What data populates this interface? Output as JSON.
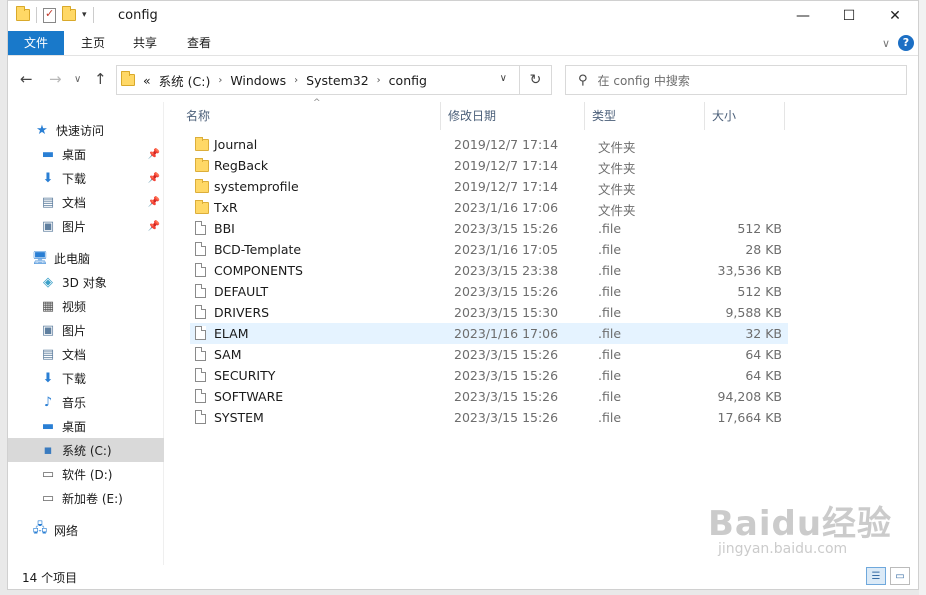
{
  "window": {
    "title": "config",
    "minimize": "—",
    "maximize": "☐",
    "close": "✕"
  },
  "ribbon": {
    "tabs": [
      "文件",
      "主页",
      "共享",
      "查看"
    ],
    "help": "?"
  },
  "address": {
    "overflow": "«",
    "crumbs": [
      "系统 (C:)",
      "Windows",
      "System32",
      "config"
    ]
  },
  "search": {
    "placeholder": "在 config 中搜索"
  },
  "sidebar": {
    "quick_access": "快速访问",
    "quick_items": [
      "桌面",
      "下载",
      "文档",
      "图片"
    ],
    "this_pc": "此电脑",
    "pc_items": [
      "3D 对象",
      "视频",
      "图片",
      "文档",
      "下载",
      "音乐",
      "桌面"
    ],
    "drives": [
      "系统 (C:)",
      "软件 (D:)",
      "新加卷 (E:)"
    ],
    "network": "网络"
  },
  "columns": {
    "name": "名称",
    "date": "修改日期",
    "type": "类型",
    "size": "大小"
  },
  "files": [
    {
      "name": "Journal",
      "date": "2019/12/7 17:14",
      "type": "文件夹",
      "size": "",
      "kind": "folder"
    },
    {
      "name": "RegBack",
      "date": "2019/12/7 17:14",
      "type": "文件夹",
      "size": "",
      "kind": "folder"
    },
    {
      "name": "systemprofile",
      "date": "2019/12/7 17:14",
      "type": "文件夹",
      "size": "",
      "kind": "folder"
    },
    {
      "name": "TxR",
      "date": "2023/1/16 17:06",
      "type": "文件夹",
      "size": "",
      "kind": "folder"
    },
    {
      "name": "BBI",
      "date": "2023/3/15 15:26",
      "type": ".file",
      "size": "512 KB",
      "kind": "file"
    },
    {
      "name": "BCD-Template",
      "date": "2023/1/16 17:05",
      "type": ".file",
      "size": "28 KB",
      "kind": "file"
    },
    {
      "name": "COMPONENTS",
      "date": "2023/3/15 23:38",
      "type": ".file",
      "size": "33,536 KB",
      "kind": "file"
    },
    {
      "name": "DEFAULT",
      "date": "2023/3/15 15:26",
      "type": ".file",
      "size": "512 KB",
      "kind": "file"
    },
    {
      "name": "DRIVERS",
      "date": "2023/3/15 15:30",
      "type": ".file",
      "size": "9,588 KB",
      "kind": "file"
    },
    {
      "name": "ELAM",
      "date": "2023/1/16 17:06",
      "type": ".file",
      "size": "32 KB",
      "kind": "file"
    },
    {
      "name": "SAM",
      "date": "2023/3/15 15:26",
      "type": ".file",
      "size": "64 KB",
      "kind": "file"
    },
    {
      "name": "SECURITY",
      "date": "2023/3/15 15:26",
      "type": ".file",
      "size": "64 KB",
      "kind": "file"
    },
    {
      "name": "SOFTWARE",
      "date": "2023/3/15 15:26",
      "type": ".file",
      "size": "94,208 KB",
      "kind": "file"
    },
    {
      "name": "SYSTEM",
      "date": "2023/3/15 15:26",
      "type": ".file",
      "size": "17,664 KB",
      "kind": "file"
    }
  ],
  "status": {
    "count": "14 个项目"
  },
  "watermark": {
    "main": "Baidu经验",
    "sub": "jingyan.baidu.com"
  },
  "colors": {
    "accent": "#1979ca",
    "selected": "#d9d9d9",
    "hover": "#e5f3ff",
    "header_text": "#4c607a"
  }
}
